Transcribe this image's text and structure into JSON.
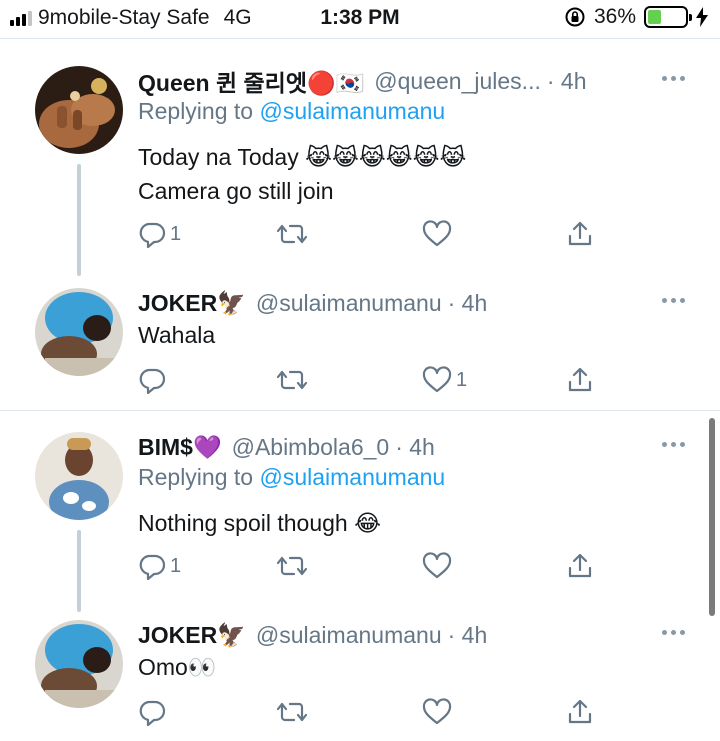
{
  "status_bar": {
    "carrier": "9mobile-Stay Safe",
    "network": "4G",
    "time": "1:38 PM",
    "battery": "36%",
    "battery_level": 0.36
  },
  "tweets": [
    {
      "name": "Queen 퀸 줄리엣🔴🇰🇷",
      "handle": "@queen_jules...",
      "time": "· 4h",
      "reply_prefix": "Replying to",
      "reply_to": "@sulaimanumanu",
      "lines": [
        "Today na Today 😹😹😹😹😹😹",
        "Camera go still join"
      ],
      "reply_count": "1",
      "retweet_count": "",
      "like_count": ""
    },
    {
      "name": "JOKER🦅",
      "handle": "@sulaimanumanu",
      "time": "· 4h",
      "lines": [
        "Wahala"
      ],
      "reply_count": "",
      "retweet_count": "",
      "like_count": "1"
    },
    {
      "name": "BIM$💜",
      "handle": "@Abimbola6_0",
      "time": "· 4h",
      "reply_prefix": "Replying to",
      "reply_to": "@sulaimanumanu",
      "lines": [
        "Nothing spoil though 😂"
      ],
      "reply_count": "1",
      "retweet_count": "",
      "like_count": ""
    },
    {
      "name": "JOKER🦅",
      "handle": "@sulaimanumanu",
      "time": "· 4h",
      "lines": [
        "Omo👀"
      ],
      "reply_count": "",
      "retweet_count": "",
      "like_count": ""
    }
  ]
}
